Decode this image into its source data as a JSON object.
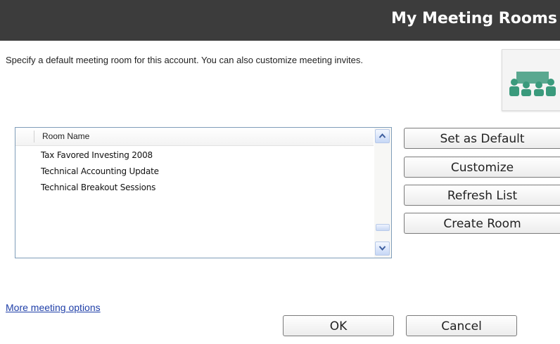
{
  "header": {
    "title": "My Meeting Rooms"
  },
  "description": "Specify a default meeting room for this account.  You can also customize meeting invites.",
  "header_icon": "meeting-room-people-icon",
  "room_list": {
    "column_header": "Room Name",
    "rows": [
      "Tax Favored Investing 2008",
      "Technical Accounting Update",
      "Technical Breakout Sessions"
    ]
  },
  "actions": {
    "set_default": "Set as Default",
    "customize": "Customize",
    "refresh": "Refresh List",
    "create": "Create Room"
  },
  "more_options_link": "More meeting options",
  "footer": {
    "ok": "OK",
    "cancel": "Cancel"
  },
  "colors": {
    "header_bg": "#3c3c3c",
    "link": "#1f3fa8",
    "icon_green": "#3a9a7c"
  }
}
